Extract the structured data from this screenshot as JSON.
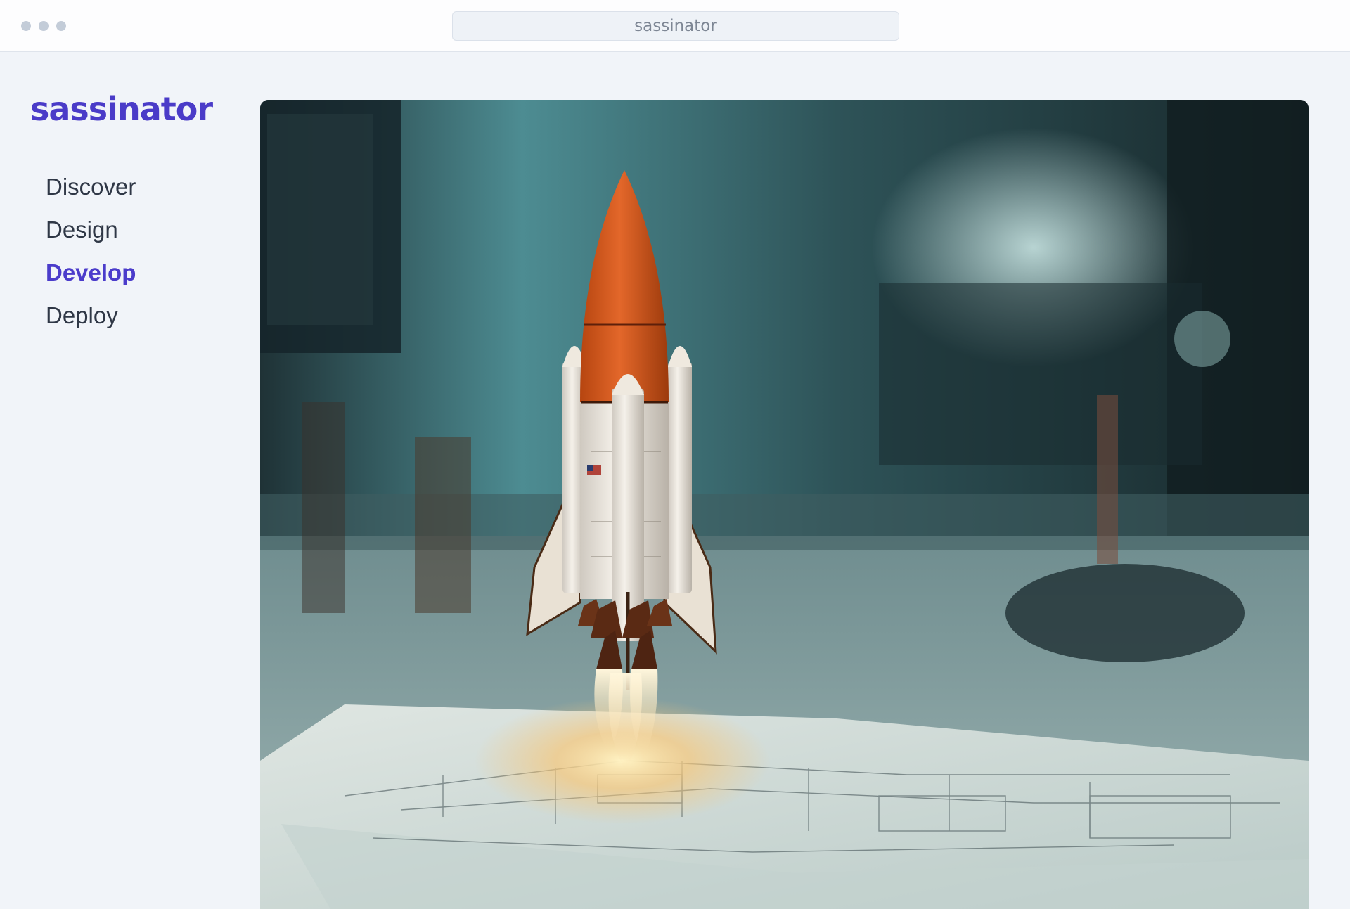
{
  "browser": {
    "url": "sassinator"
  },
  "sidebar": {
    "brand": "sassinator",
    "items": [
      {
        "label": "Discover",
        "active": false
      },
      {
        "label": "Design",
        "active": false
      },
      {
        "label": "Develop",
        "active": true
      },
      {
        "label": "Deploy",
        "active": false
      }
    ]
  },
  "hero": {
    "icon": "rocket-launch-photo"
  },
  "colors": {
    "accent": "#4a3bc8",
    "nav_text": "#2f3746",
    "background": "#f1f4f9"
  }
}
